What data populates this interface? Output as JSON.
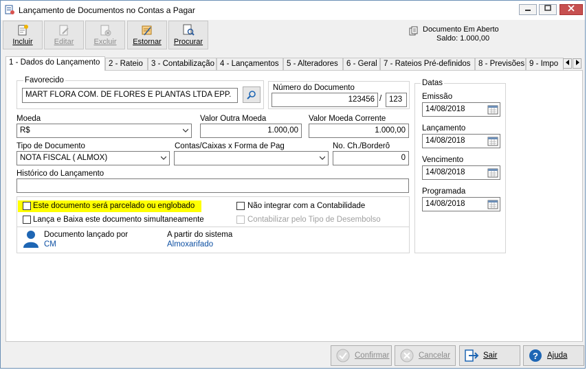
{
  "window": {
    "title": "Lançamento de Documentos no Contas a Pagar"
  },
  "toolbar": {
    "incluir": "Incluir",
    "editar": "Editar",
    "excluir": "Excluir",
    "estornar": "Estornar",
    "procurar": "Procurar"
  },
  "status": {
    "line1": "Documento Em Aberto",
    "line2": "Saldo: 1.000,00"
  },
  "tabs": [
    "1 - Dados do Lançamento",
    "2 - Rateio",
    "3 - Contabilização",
    "4 - Lançamentos",
    "5 - Alteradores",
    "6 - Geral",
    "7 - Rateios Pré-definidos",
    "8 - Previsões",
    "9 - Impo"
  ],
  "favorecido": {
    "label": "Favorecido",
    "value": "MART FLORA COM. DE FLORES E PLANTAS LTDA EPP."
  },
  "numero_documento": {
    "label": "Número do Documento",
    "numero": "123456",
    "separador": "/",
    "parcela": "123"
  },
  "moeda": {
    "label": "Moeda",
    "value": "R$"
  },
  "valor_outra_moeda": {
    "label": "Valor Outra Moeda",
    "value": "1.000,00"
  },
  "valor_moeda_corrente": {
    "label": "Valor Moeda Corrente",
    "value": "1.000,00"
  },
  "tipo_documento": {
    "label": "Tipo de Documento",
    "value": "NOTA FISCAL ( ALMOX)"
  },
  "contas_caixas": {
    "label": "Contas/Caixas x Forma de Pag",
    "value": ""
  },
  "no_bordero": {
    "label": "No. Ch./Borderô",
    "value": "0"
  },
  "historico": {
    "label": "Histórico do Lançamento",
    "value": ""
  },
  "options": {
    "parcelado": "Este documento será parcelado ou englobado",
    "lanca_baixa": "Lança e Baixa este documento simultaneamente",
    "nao_integrar": "Não integrar com a Contabilidade",
    "contabilizar_tipo": "Contabilizar pelo Tipo de Desembolso"
  },
  "lancado_por": {
    "label": "Documento lançado por",
    "value": "CM"
  },
  "sistema": {
    "label": "A partir do sistema",
    "value": "Almoxarifado"
  },
  "datas": {
    "title": "Datas",
    "emissao": {
      "label": "Emissão",
      "value": "14/08/2018"
    },
    "lancamento": {
      "label": "Lançamento",
      "value": "14/08/2018"
    },
    "vencimento": {
      "label": "Vencimento",
      "value": "14/08/2018"
    },
    "programada": {
      "label": "Programada",
      "value": "14/08/2018"
    }
  },
  "buttons": {
    "confirmar": "Confirmar",
    "cancelar": "Cancelar",
    "sair": "Sair",
    "ajuda": "Ajuda"
  },
  "colors": {
    "highlight": "#ffff00",
    "link_blue": "#0b4ea2",
    "accent_blue": "#1e66b4"
  }
}
